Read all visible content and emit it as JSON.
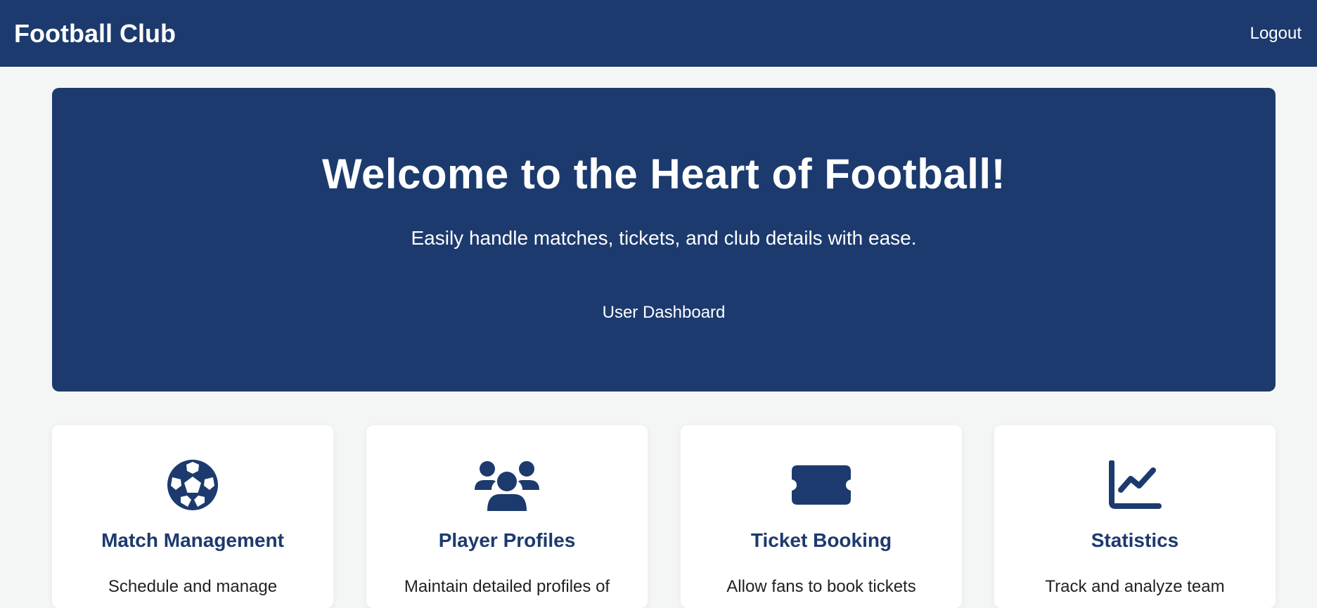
{
  "navbar": {
    "brand": "Football Club",
    "logout_label": "Logout"
  },
  "hero": {
    "title": "Welcome to the Heart of Football!",
    "subtitle": "Easily handle matches, tickets, and club details with ease.",
    "cta_label": "User Dashboard"
  },
  "features": [
    {
      "icon": "soccer-ball-icon",
      "title": "Match Management",
      "description": "Schedule and manage"
    },
    {
      "icon": "users-group-icon",
      "title": "Player Profiles",
      "description": "Maintain detailed profiles of"
    },
    {
      "icon": "ticket-icon",
      "title": "Ticket Booking",
      "description": "Allow fans to book tickets"
    },
    {
      "icon": "chart-line-icon",
      "title": "Statistics",
      "description": "Track and analyze team"
    }
  ],
  "colors": {
    "primary": "#1c3a6d",
    "background": "#f4f6f5",
    "card": "#ffffff"
  }
}
